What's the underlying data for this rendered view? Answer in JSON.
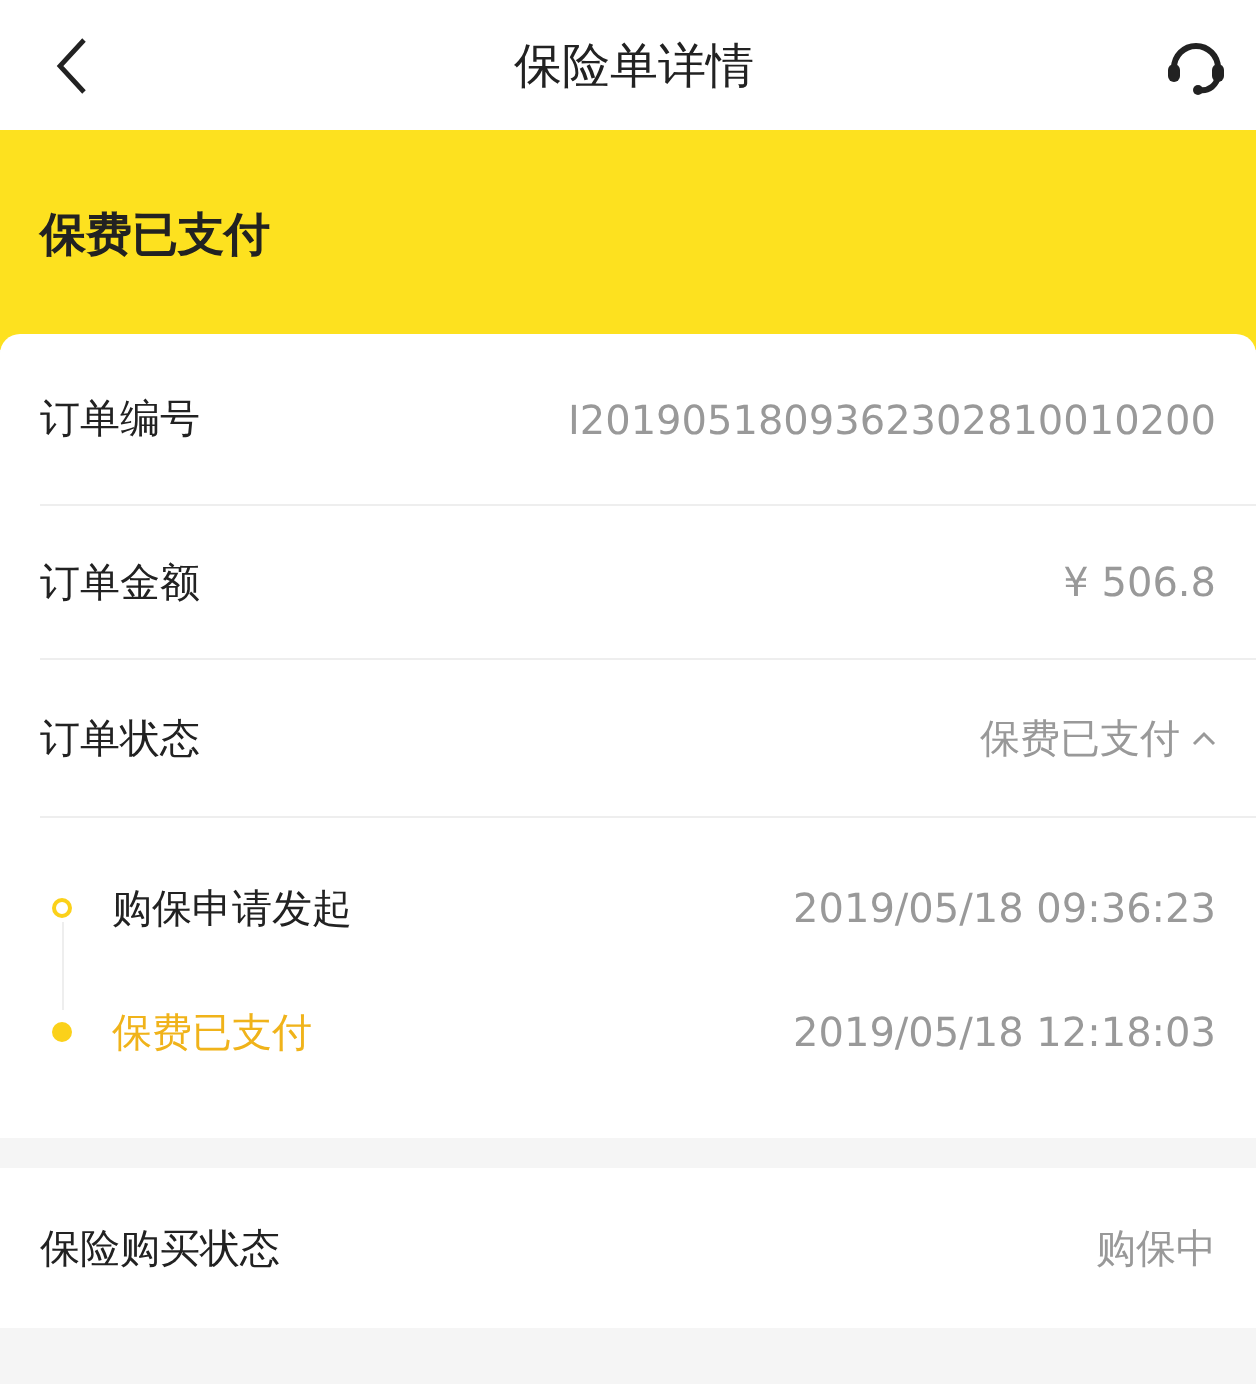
{
  "header": {
    "title": "保险单详情"
  },
  "banner": {
    "status": "保费已支付"
  },
  "order": {
    "rows": [
      {
        "label": "订单编号",
        "value": "I2019051809362302810010200"
      },
      {
        "label": "订单金额",
        "value": "¥ 506.8"
      }
    ],
    "status": {
      "label": "订单状态",
      "value": "保费已支付",
      "expanded": true
    },
    "timeline": [
      {
        "label": "购保申请发起",
        "time": "2019/05/18 09:36:23",
        "active": false
      },
      {
        "label": "保费已支付",
        "time": "2019/05/18 12:18:03",
        "active": true
      }
    ]
  },
  "purchase": {
    "label": "保险购买状态",
    "value": "购保中"
  }
}
